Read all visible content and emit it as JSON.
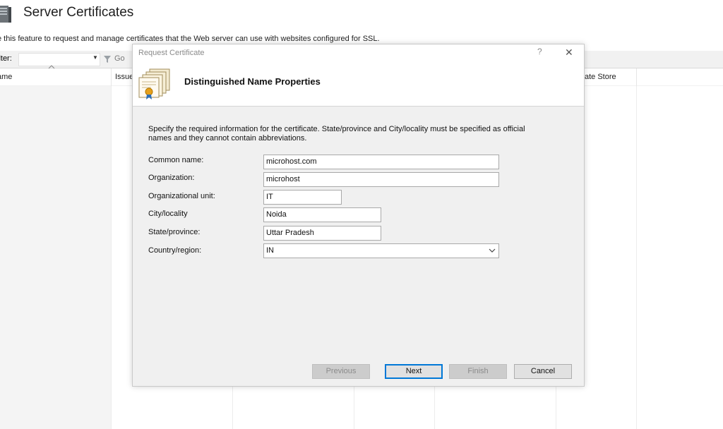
{
  "page": {
    "title": "Server Certificates",
    "description": "e this feature to request and manage certificates that the Web server can use with websites configured for SSL.",
    "filter_label": "ilter:",
    "go_label": "Go",
    "columns": [
      "ame",
      "Issue",
      "ate Store"
    ]
  },
  "dialog": {
    "window_title": "Request Certificate",
    "help_glyph": "?",
    "close_glyph": "✕",
    "heading": "Distinguished Name Properties",
    "instructions": "Specify the required information for the certificate. State/province and City/locality must be specified as official names and they cannot contain abbreviations.",
    "fields": {
      "common_name": {
        "label": "Common name:",
        "value": "microhost.com"
      },
      "organization": {
        "label": "Organization:",
        "value": "microhost"
      },
      "org_unit": {
        "label": "Organizational unit:",
        "value": "IT"
      },
      "city": {
        "label": "City/locality",
        "value": "Noida"
      },
      "state": {
        "label": "State/province:",
        "value": "Uttar Pradesh"
      },
      "country": {
        "label": "Country/region:",
        "value": "IN"
      }
    },
    "buttons": {
      "previous": "Previous",
      "next": "Next",
      "finish": "Finish",
      "cancel": "Cancel"
    }
  },
  "icons": {
    "page_icon": "server-icon",
    "dialog_icon": "certificate-icon",
    "filter_icon": "funnel-icon",
    "dropdown_icon": "chevron-down-icon"
  },
  "colors": {
    "accent": "#0078d7",
    "dialog_bg": "#f0f0f0",
    "disabled_button": "#cccccc"
  }
}
